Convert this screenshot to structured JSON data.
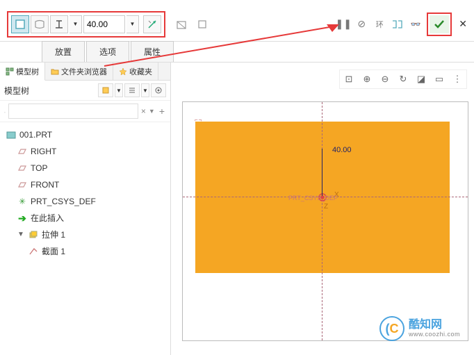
{
  "toolbar": {
    "depth_value": "40.00"
  },
  "sub_tabs": {
    "placement": "放置",
    "options": "选项",
    "properties": "属性"
  },
  "panel_tabs": {
    "model_tree": "模型树",
    "file_browser": "文件夹浏览器",
    "favorites": "收藏夹"
  },
  "tree_header": "模型树",
  "tree": {
    "part": "001.PRT",
    "right": "RIGHT",
    "top": "TOP",
    "front": "FRONT",
    "csys": "PRT_CSYS_DEF",
    "insert_here": "在此插入",
    "extrude": "拉伸 1",
    "section": "截面 1"
  },
  "viewport": {
    "dim_value": "40.00",
    "axis_x": "X",
    "axis_z": "Z",
    "csys_label": "PRT_CSYS_DEF"
  },
  "watermark": {
    "cn": "酷知网",
    "en": "www.coozhi.com"
  }
}
